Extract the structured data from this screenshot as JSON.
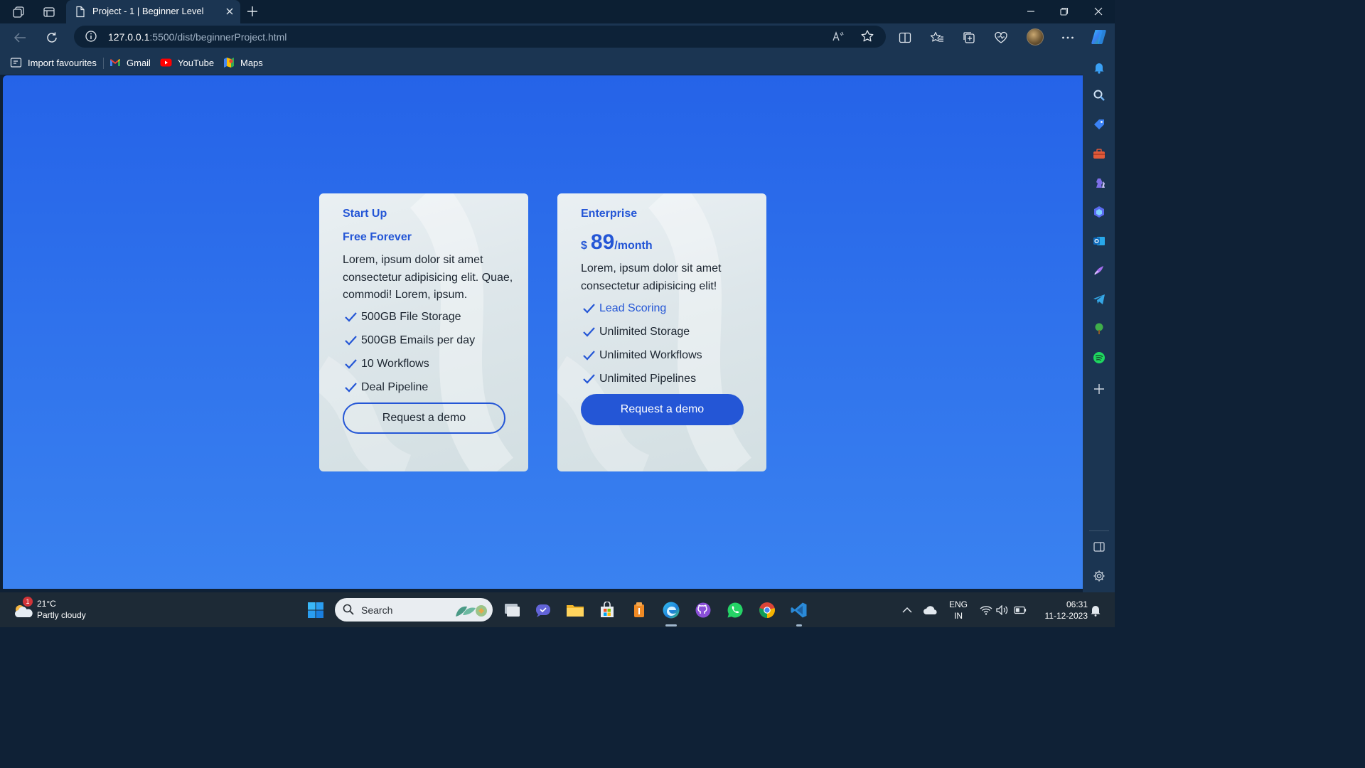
{
  "browser": {
    "tab_title": "Project - 1 | Beginner Level",
    "url_host": "127.0.0.1",
    "url_path": ":5500/dist/beginnerProject.html",
    "favourites": [
      "Import favourites",
      "Gmail",
      "YouTube",
      "Maps"
    ]
  },
  "pricing": {
    "startup": {
      "title": "Start Up",
      "subtitle": "Free Forever",
      "description": "Lorem, ipsum dolor sit amet consectetur adipisicing elit. Quae, commodi! Lorem, ipsum.",
      "features": [
        "500GB File Storage",
        "500GB Emails per day",
        "10 Workflows",
        "Deal Pipeline"
      ],
      "button": "Request a demo"
    },
    "enterprise": {
      "title": "Enterprise",
      "currency": "$",
      "price": "89",
      "period": "/month",
      "description": "Lorem, ipsum dolor sit amet consectetur adipisicing elit!",
      "features": [
        "Lead Scoring",
        "Unlimited Storage",
        "Unlimited Workflows",
        "Unlimited Pipelines"
      ],
      "button": "Request a demo"
    }
  },
  "taskbar": {
    "weather_temp": "21°C",
    "weather_condition": "Partly cloudy",
    "weather_badge": "1",
    "search_placeholder": "Search",
    "language_line1": "ENG",
    "language_line2": "IN",
    "time": "06:31",
    "date": "11-12-2023"
  },
  "colors": {
    "accent": "#2456d6",
    "page_gradient_top": "#2563e8",
    "page_gradient_bottom": "#3a82f0",
    "browser_chrome": "#1b3552"
  }
}
